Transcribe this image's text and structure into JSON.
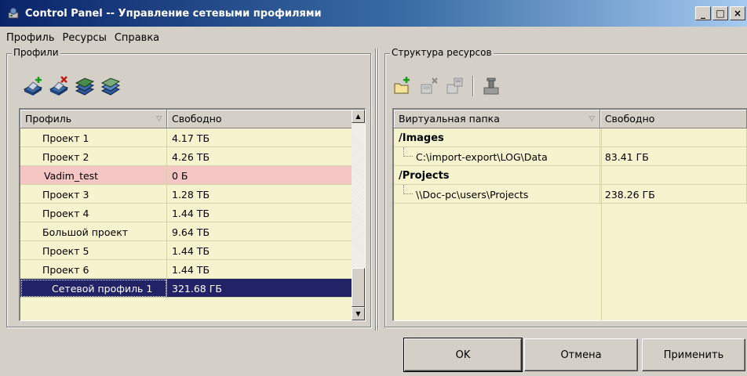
{
  "window": {
    "title": "Control Panel -- Управление сетевыми профилями",
    "controls": {
      "minimize": "_",
      "maximize": "□",
      "close": "×"
    }
  },
  "menu": [
    "Профиль",
    "Ресурсы",
    "Справка"
  ],
  "profiles_panel": {
    "legend": "Профили",
    "toolbar_icons": [
      "add-profile-icon",
      "delete-profile-icon",
      "profiles-stack-icon",
      "profiles-stack-alt-icon"
    ],
    "columns": [
      "Профиль",
      "Свободно"
    ],
    "rows": [
      {
        "name": "Проект 1",
        "free": "4.17 ТБ",
        "state": "normal"
      },
      {
        "name": "Проект 2",
        "free": "4.26 ТБ",
        "state": "normal"
      },
      {
        "name": "Vadim_test",
        "free": "0 Б",
        "state": "error"
      },
      {
        "name": "Проект 3",
        "free": "1.28 ТБ",
        "state": "normal"
      },
      {
        "name": "Проект 4",
        "free": "1.44 ТБ",
        "state": "normal"
      },
      {
        "name": "Большой проект",
        "free": "9.64 ТБ",
        "state": "normal"
      },
      {
        "name": "Проект 5",
        "free": "1.44 ТБ",
        "state": "normal"
      },
      {
        "name": "Проект 6",
        "free": "1.44 ТБ",
        "state": "normal"
      },
      {
        "name": "Сетевой профиль 1",
        "free": "321.68 ГБ",
        "state": "selected"
      }
    ],
    "scroll_position": 0.92
  },
  "resources_panel": {
    "legend": "Структура ресурсов",
    "toolbar_icons": [
      "add-folder-icon",
      "remove-folder-icon",
      "edit-folder-icon",
      "connect-drive-icon"
    ],
    "columns": [
      "Виртуальная папка",
      "Свободно"
    ],
    "tree": [
      {
        "folder": "/Images",
        "path": "C:\\import-export\\LOG\\Data",
        "free": "83.41 ГБ"
      },
      {
        "folder": "/Projects",
        "path": "\\\\Doc-pc\\users\\Projects",
        "free": "238.26 ГБ"
      }
    ]
  },
  "buttons": {
    "ok": "OK",
    "cancel": "Отмена",
    "apply": "Применить"
  },
  "colors": {
    "grid_bg": "#f6f4cf",
    "error_row": "#f6c6c4",
    "selected_row": "#222266",
    "title_start": "#0a246a",
    "title_end": "#a6caf0"
  }
}
